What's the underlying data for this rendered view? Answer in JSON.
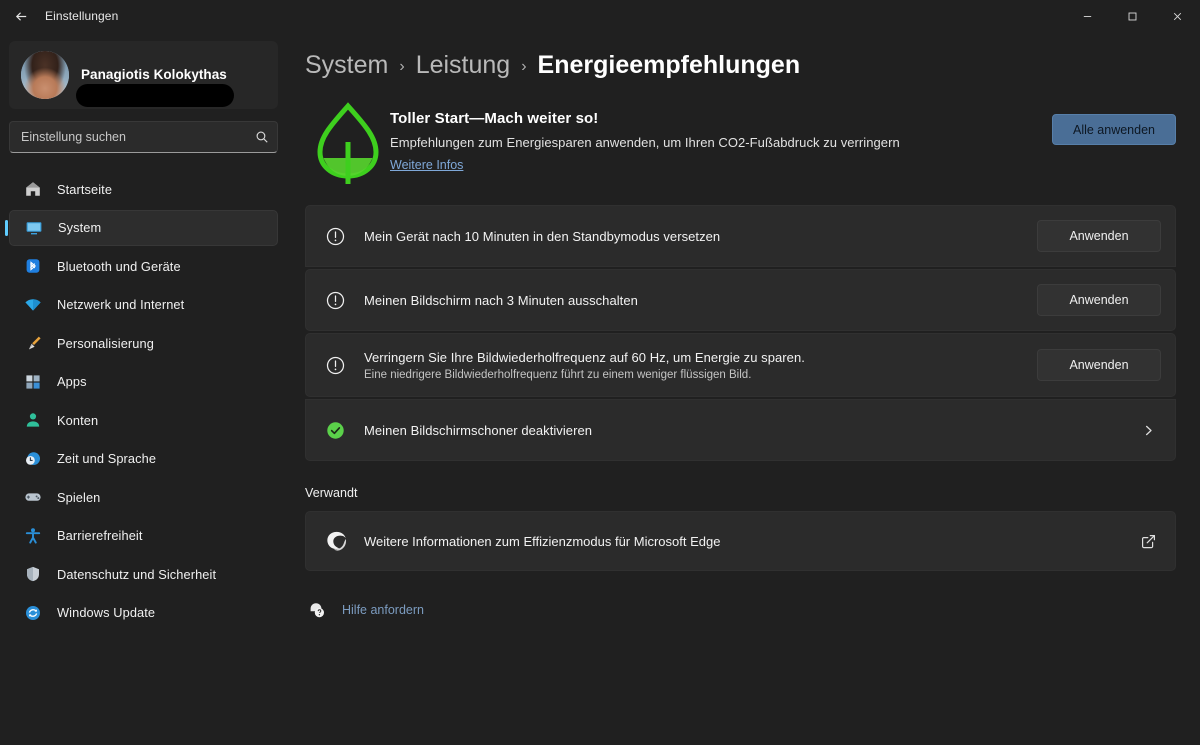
{
  "window": {
    "title": "Einstellungen",
    "back_icon": "back-arrow-icon",
    "minimize_label": "Minimieren",
    "maximize_label": "Maximieren",
    "close_label": "Schließen"
  },
  "sidebar": {
    "profile": {
      "name": "Panagiotis Kolokythas",
      "email": ""
    },
    "search": {
      "placeholder": "Einstellung suchen",
      "value": "",
      "icon": "search-icon"
    },
    "items": [
      {
        "label": "Startseite",
        "icon": "home-icon",
        "selected": false
      },
      {
        "label": "System",
        "icon": "system-display-icon",
        "selected": true
      },
      {
        "label": "Bluetooth und Geräte",
        "icon": "bluetooth-icon",
        "selected": false
      },
      {
        "label": "Netzwerk und Internet",
        "icon": "wifi-icon",
        "selected": false
      },
      {
        "label": "Personalisierung",
        "icon": "paintbrush-icon",
        "selected": false
      },
      {
        "label": "Apps",
        "icon": "apps-grid-icon",
        "selected": false
      },
      {
        "label": "Konten",
        "icon": "account-person-icon",
        "selected": false
      },
      {
        "label": "Zeit und Sprache",
        "icon": "clock-globe-icon",
        "selected": false
      },
      {
        "label": "Spielen",
        "icon": "gamepad-icon",
        "selected": false
      },
      {
        "label": "Barrierefreiheit",
        "icon": "accessibility-person-icon",
        "selected": false
      },
      {
        "label": "Datenschutz und Sicherheit",
        "icon": "shield-icon",
        "selected": false
      },
      {
        "label": "Windows Update",
        "icon": "update-refresh-icon",
        "selected": false
      }
    ]
  },
  "breadcrumb": {
    "root": "System",
    "parent": "Leistung",
    "current": "Energieempfehlungen",
    "separator": "›"
  },
  "hero": {
    "icon": "leaf-icon",
    "title": "Toller Start—Mach weiter so!",
    "subtitle": "Empfehlungen zum Energiesparen anwenden, um Ihren CO2-Fußabdruck zu verringern",
    "link": "Weitere Infos",
    "apply_all_button": "Alle anwenden"
  },
  "recommendations": [
    {
      "status": "pending",
      "icon": "alert-circle-icon",
      "title": "Mein Gerät nach 10 Minuten in den Standbymodus versetzen",
      "description": "",
      "action": "Anwenden"
    },
    {
      "status": "pending",
      "icon": "alert-circle-icon",
      "title": "Meinen Bildschirm nach 3 Minuten ausschalten",
      "description": "",
      "action": "Anwenden"
    },
    {
      "status": "pending",
      "icon": "alert-circle-icon",
      "title": "Verringern Sie Ihre Bildwiederholfrequenz auf 60 Hz, um Energie zu sparen.",
      "description": "Eine niedrigere Bildwiederholfrequenz führt zu einem weniger flüssigen Bild.",
      "action": "Anwenden"
    },
    {
      "status": "done",
      "icon": "check-circle-icon",
      "title": "Meinen Bildschirmschoner deaktivieren",
      "description": "",
      "action": ""
    }
  ],
  "related": {
    "heading": "Verwandt",
    "item": {
      "icon": "edge-browser-icon",
      "label": "Weitere Informationen zum Effizienzmodus für Microsoft Edge",
      "external_icon": "open-external-icon"
    }
  },
  "help": {
    "icon": "help-question-icon",
    "label": "Hilfe anfordern"
  },
  "colors": {
    "page_background": "#202020",
    "card_background": "#2b2b2b",
    "accent_button": "#4a6e96",
    "selection_indicator": "#60cdff",
    "leaf_green": "#3ecf1e",
    "success_green": "#5bd14a",
    "link_blue": "#7fa8d8"
  }
}
